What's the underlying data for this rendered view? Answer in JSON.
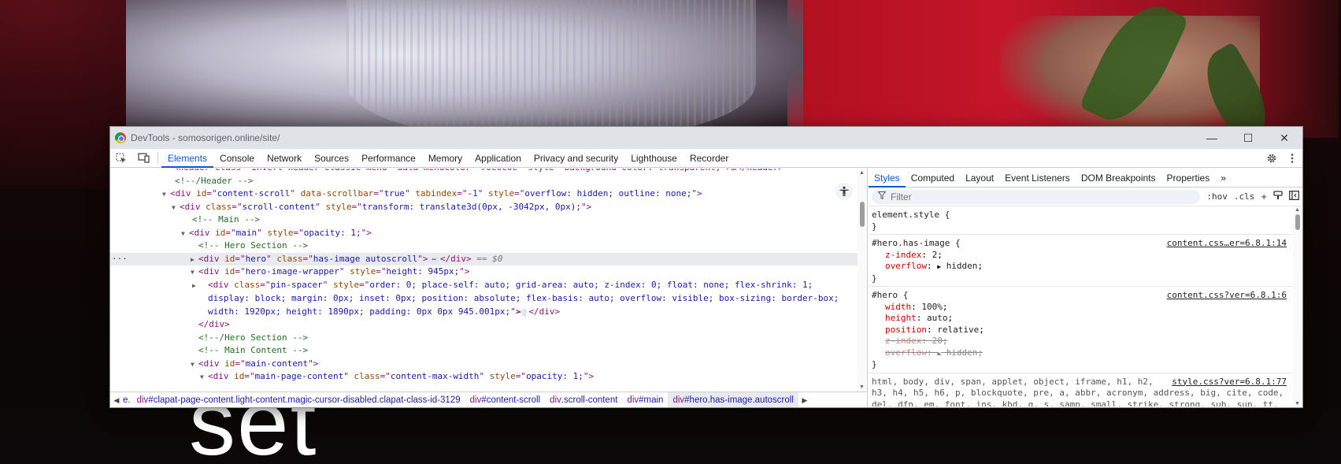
{
  "background": {
    "big_text": "set"
  },
  "window": {
    "title": "DevTools - somosorigen.online/site/",
    "minimize": "—",
    "maximize": "☐",
    "close": "✕"
  },
  "toolbar": {
    "tabs": [
      "Elements",
      "Console",
      "Network",
      "Sources",
      "Performance",
      "Memory",
      "Application",
      "Privacy and security",
      "Lighthouse",
      "Recorder"
    ],
    "active_tab": "Elements"
  },
  "dom": {
    "selected_marker": "== $0",
    "badge": "⋯",
    "lines": [
      {
        "type": "raw",
        "text": "<header class=\"invert-header classic-menu\" data-menucolor=\"#0c0c0c\" style=\"background-color: transparent;\">…</header>"
      },
      {
        "type": "comment",
        "text": "<!--/Header -->"
      },
      {
        "open_tag": "div",
        "attrs": [
          [
            "id",
            "content-scroll"
          ],
          [
            "data-scrollbar",
            "true"
          ],
          [
            "tabindex",
            "-1"
          ],
          [
            "style",
            "overflow: hidden; outline: none;"
          ]
        ]
      },
      {
        "open_tag": "div",
        "attrs": [
          [
            "class",
            "scroll-content"
          ],
          [
            "style",
            "transform: translate3d(0px, -3042px, 0px);"
          ]
        ]
      },
      {
        "type": "comment",
        "text": "<!-- Main -->"
      },
      {
        "open_tag": "div",
        "attrs": [
          [
            "id",
            "main"
          ],
          [
            "style",
            "opacity: 1;"
          ]
        ]
      },
      {
        "type": "comment",
        "text": "<!-- Hero Section -->"
      },
      {
        "open_tag": "div",
        "attrs": [
          [
            "id",
            "hero"
          ],
          [
            "class",
            "has-image autoscroll"
          ]
        ],
        "close_tag": "</div>"
      },
      {
        "open_tag": "div",
        "attrs": [
          [
            "id",
            "hero-image-wrapper"
          ],
          [
            "style",
            "height: 945px;"
          ]
        ]
      },
      {
        "open_tag": "div",
        "attrs": [
          [
            "class",
            "pin-spacer"
          ],
          [
            "style",
            "order: 0; place-self: auto; grid-area: auto; z-index: 0; float: none; flex-shrink: 1; display: block; margin: 0px; inset: 0px; position: absolute; flex-basis: auto; overflow: visible; box-sizing: border-box; width: 1920px; height: 1890px; padding: 0px 0px 945.001px;"
          ]
        ],
        "close_tag": "</div>"
      },
      {
        "type": "close",
        "text": "</div>"
      },
      {
        "type": "comment",
        "text": "<!--/Hero Section -->"
      },
      {
        "type": "comment",
        "text": "<!-- Main Content -->"
      },
      {
        "open_tag": "div",
        "attrs": [
          [
            "id",
            "main-content"
          ]
        ]
      },
      {
        "open_tag": "div",
        "attrs": [
          [
            "id",
            "main-page-content"
          ],
          [
            "class",
            "content-max-width"
          ],
          [
            "style",
            "opacity: 1;"
          ]
        ]
      }
    ]
  },
  "breadcrumbs": [
    {
      "tag": "div",
      "cls": "#clapat-page-content.light-content.magic-cursor-disabled.clapat-class-id-3129"
    },
    {
      "tag": "div",
      "cls": "#content-scroll"
    },
    {
      "tag": "div",
      "cls": ".scroll-content"
    },
    {
      "tag": "div",
      "cls": "#main"
    },
    {
      "tag": "div",
      "cls": "#hero.has-image.autoscroll"
    }
  ],
  "styles": {
    "tabs": [
      "Styles",
      "Computed",
      "Layout",
      "Event Listeners",
      "DOM Breakpoints",
      "Properties"
    ],
    "more": "»",
    "filter_placeholder": "Filter",
    "hov": ":hov",
    "cls": ".cls",
    "element_style": "element.style {",
    "close_brace": "}",
    "rule1": {
      "selector": "#hero.has-image {",
      "source": "content.css…er=6.8.1:14",
      "decls": [
        {
          "name": "z-index",
          "value": "2"
        },
        {
          "name": "overflow",
          "value": "hidden"
        }
      ]
    },
    "rule2": {
      "selector": "#hero {",
      "source": "content.css?ver=6.8.1:6",
      "decls": [
        {
          "name": "width",
          "value": "100%"
        },
        {
          "name": "height",
          "value": "auto"
        },
        {
          "name": "position",
          "value": "relative"
        }
      ],
      "struck": [
        {
          "name": "z-index",
          "value": "20"
        },
        {
          "name": "overflow",
          "value": "hidden"
        }
      ]
    },
    "rule3": {
      "source": "style.css?ver=6.8.1:77",
      "selector_line1": "html, body, div, span, applet, object, iframe, h1, h2,",
      "selector_line2": "h3, h4, h5, h6, p, blockquote, pre, a, abbr, acronym, address, big, cite, code,",
      "selector_line3": "del, dfn, em, font, ins, kbd, q, s, samp, small, strike, strong, sub, sup, tt,"
    }
  }
}
